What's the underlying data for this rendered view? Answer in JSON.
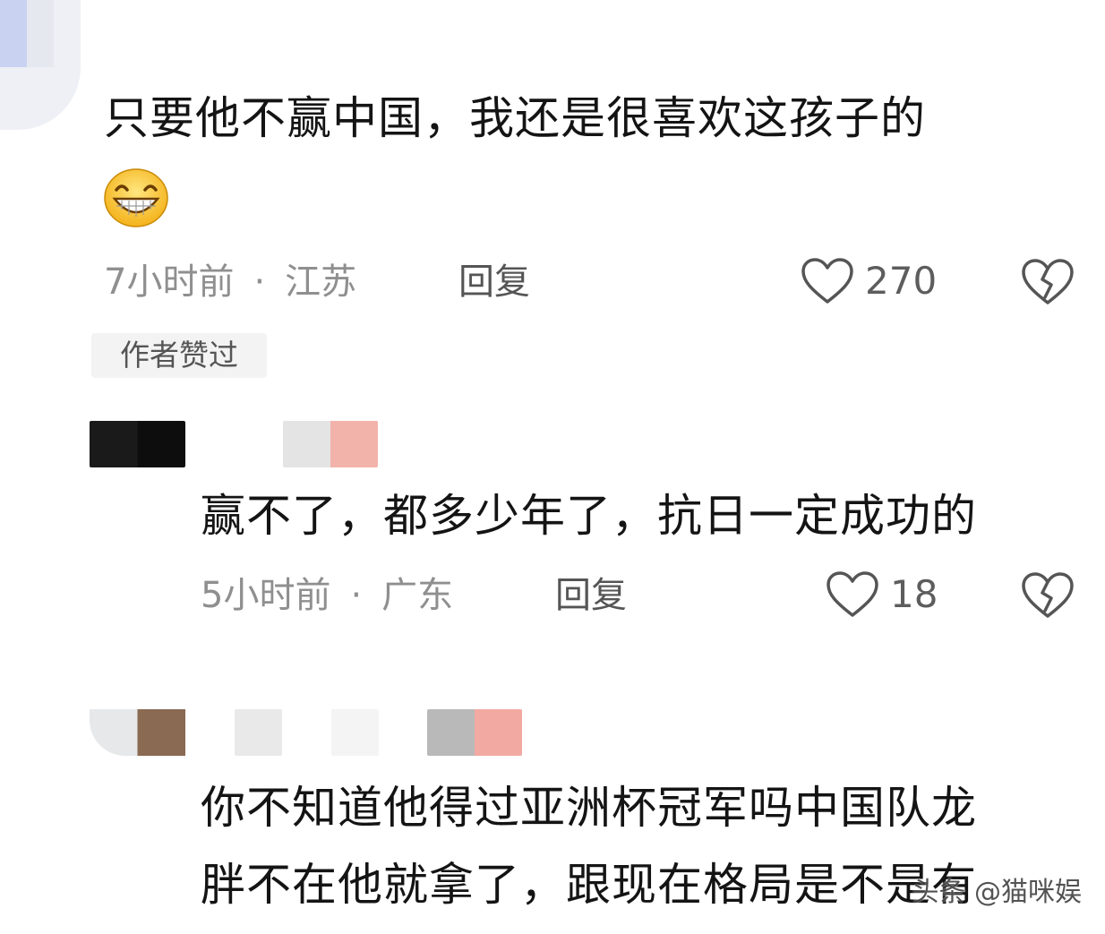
{
  "comments": [
    {
      "text": "只要他不赢中国，我还是很喜欢这孩子的",
      "time": "7小时前",
      "location": "江苏",
      "separator": "·",
      "reply_label": "回复",
      "likes": "270",
      "badge": "作者赞过",
      "emoji": "grinning-face-icon"
    },
    {
      "text": "赢不了，都多少年了，抗日一定成功的",
      "time": "5小时前",
      "location": "广东",
      "separator": "·",
      "reply_label": "回复",
      "likes": "18"
    },
    {
      "text_line1": "你不知道他得过亚洲杯冠军吗中国队龙",
      "text_line2": "胖不在他就拿了，跟现在格局是不是有"
    }
  ],
  "watermark": "头条 @猫咪娱",
  "colors": {
    "text": "#141414",
    "meta": "#8f8f8f",
    "icon": "#555555"
  }
}
